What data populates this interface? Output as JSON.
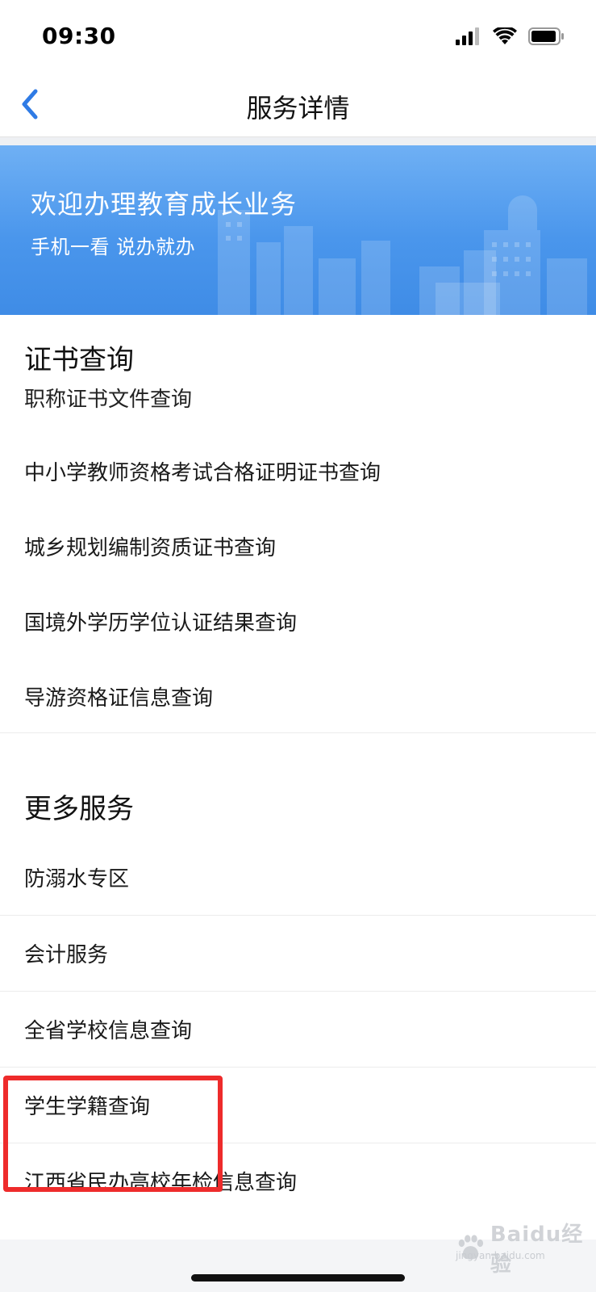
{
  "status_bar": {
    "time": "09:30"
  },
  "nav": {
    "title": "服务详情"
  },
  "banner": {
    "title": "欢迎办理教育成长业务",
    "subtitle": "手机一看 说办就办"
  },
  "sections": [
    {
      "title": "证书查询",
      "clipped_item": "职称证书文件查询",
      "items": [
        {
          "label": "中小学教师资格考试合格证明证书查询"
        },
        {
          "label": "城乡规划编制资质证书查询"
        },
        {
          "label": "国境外学历学位认证结果查询"
        },
        {
          "label": "导游资格证信息查询"
        }
      ]
    },
    {
      "title": "更多服务",
      "items": [
        {
          "label": "防溺水专区"
        },
        {
          "label": "会计服务"
        },
        {
          "label": "全省学校信息查询"
        },
        {
          "label": "学生学籍查询"
        },
        {
          "label": "江西省民办高校年检信息查询"
        }
      ]
    }
  ],
  "colors": {
    "banner": "#4a96ec",
    "accent": "#2f7be5",
    "highlight": "#ee2b2b"
  },
  "icons": [
    "signal-icon",
    "wifi-icon",
    "battery-icon",
    "back-arrow-icon"
  ],
  "watermark": {
    "text": "Baidu经验",
    "sub": "jingyan.baidu.com"
  }
}
